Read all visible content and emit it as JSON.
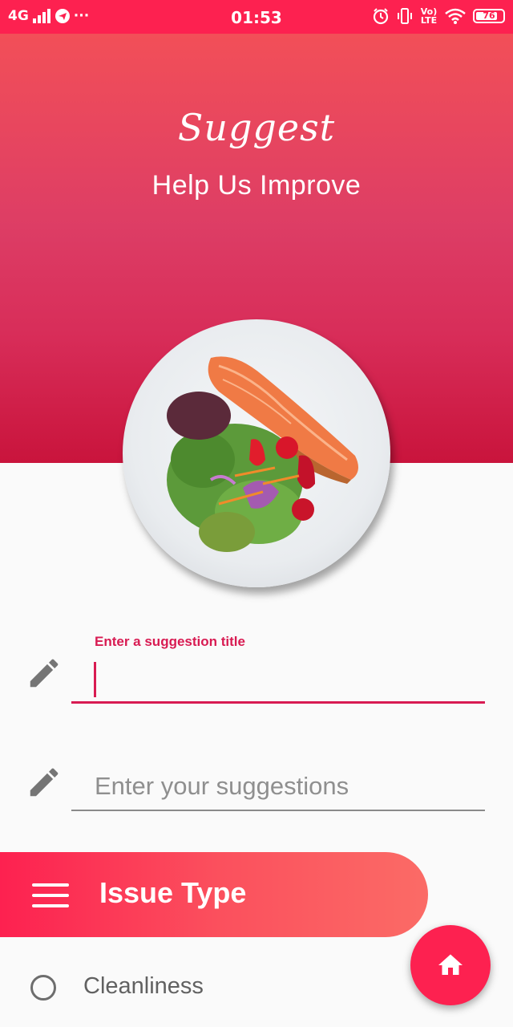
{
  "status_bar": {
    "network": "4G",
    "dots": "···",
    "time": "01:53",
    "volte": "Vo) LTE",
    "battery_level": "76",
    "icons": [
      "signal-icon",
      "telegram-icon",
      "alarm-icon",
      "vibrate-icon",
      "volte-icon",
      "wifi-icon",
      "battery-icon"
    ]
  },
  "hero": {
    "title": "Suggest",
    "subtitle": "Help Us Improve",
    "image": "salmon-salad-plate"
  },
  "form": {
    "title_field": {
      "label": "Enter a suggestion title",
      "value": "",
      "icon": "pencil-icon"
    },
    "suggestion_field": {
      "placeholder": "Enter your suggestions",
      "value": "",
      "icon": "pencil-icon"
    }
  },
  "issue_section": {
    "title": "Issue Type",
    "icon": "menu-icon",
    "options": [
      {
        "label": "Cleanliness",
        "selected": false
      }
    ]
  },
  "fab": {
    "icon": "home-icon"
  },
  "colors": {
    "accent": "#fd2150",
    "label_active": "#d81b52",
    "background": "#fafafa"
  }
}
